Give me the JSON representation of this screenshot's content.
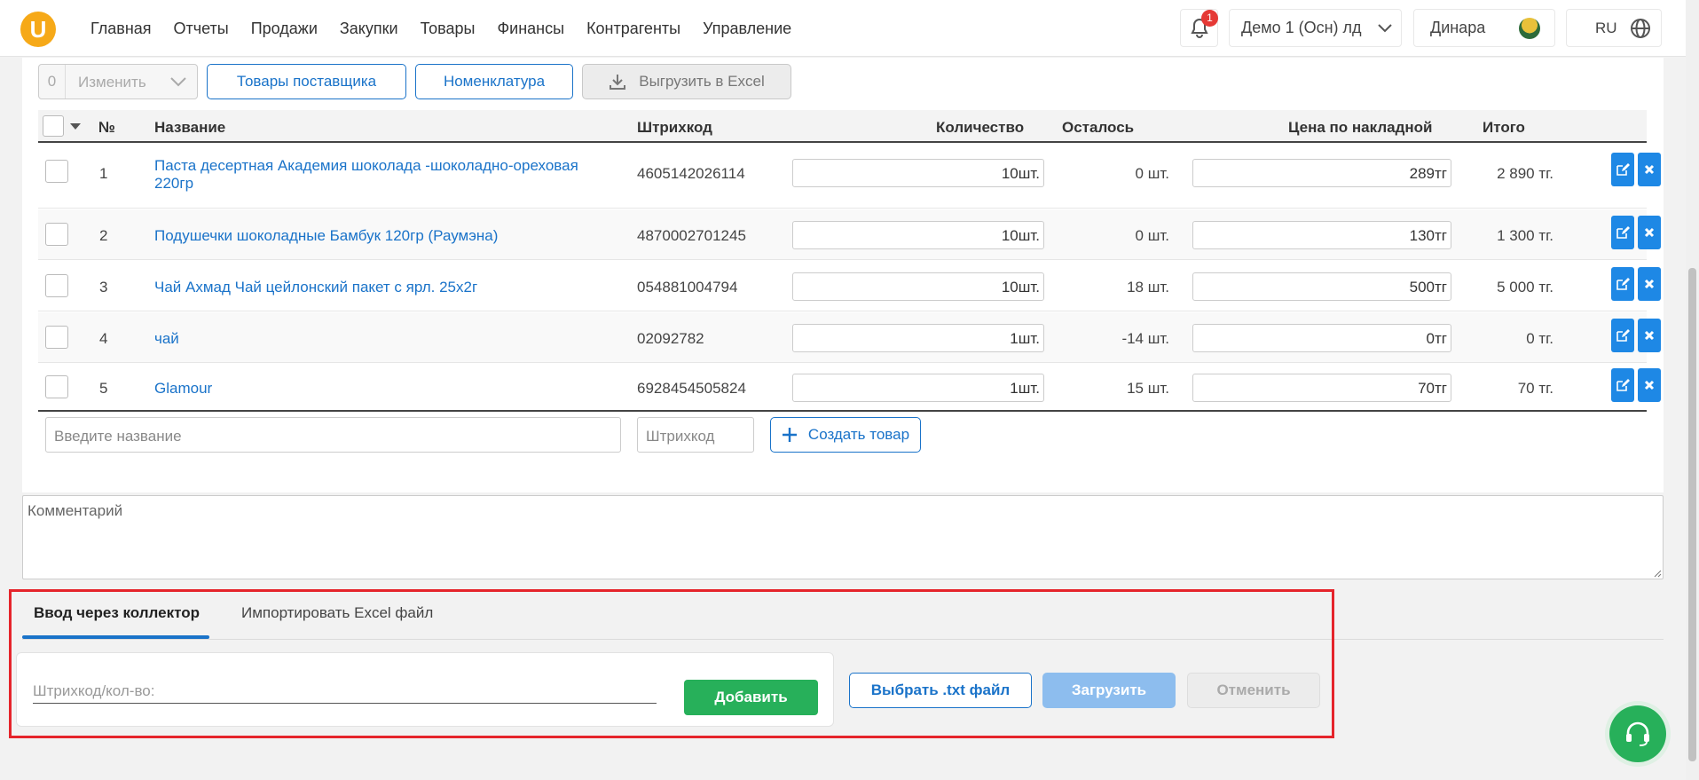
{
  "header": {
    "logo": "U",
    "nav": [
      "Главная",
      "Отчеты",
      "Продажи",
      "Закупки",
      "Товары",
      "Финансы",
      "Контрагенты",
      "Управление"
    ],
    "notifications_count": "1",
    "store": "Демо 1 (Осн) лд",
    "user": "Динара",
    "language": "RU"
  },
  "toolbar": {
    "selected_count": "0",
    "change_label": "Изменить",
    "supplier_goods": "Товары поставщика",
    "nomenclature": "Номенклатура",
    "export_excel": "Выгрузить в Excel"
  },
  "table": {
    "headers": {
      "num": "№",
      "name": "Название",
      "barcode": "Штрихкод",
      "qty": "Количество",
      "left": "Осталось",
      "price": "Цена по накладной",
      "total": "Итого"
    },
    "rows": [
      {
        "num": "1",
        "name": "Паста десертная Академия шоколада -шоколадно-ореховая 220гр",
        "barcode": "4605142026114",
        "qty": "10шт.",
        "left": "0 шт.",
        "price": "289тг",
        "total": "2 890 тг."
      },
      {
        "num": "2",
        "name": "Подушечки шоколадные Бамбук 120гр (Раумэна)",
        "barcode": "4870002701245",
        "qty": "10шт.",
        "left": "0 шт.",
        "price": "130тг",
        "total": "1 300 тг."
      },
      {
        "num": "3",
        "name": "Чай Ахмад Чай цейлонский пакет с ярл. 25х2г",
        "barcode": "054881004794",
        "qty": "10шт.",
        "left": "18 шт.",
        "price": "500тг",
        "total": "5 000 тг."
      },
      {
        "num": "4",
        "name": "чай",
        "barcode": "02092782",
        "qty": "1шт.",
        "left": "-14 шт.",
        "price": "0тг",
        "total": "0 тг."
      },
      {
        "num": "5",
        "name": "Glamour",
        "barcode": "6928454505824",
        "qty": "1шт.",
        "left": "15 шт.",
        "price": "70тг",
        "total": "70 тг."
      }
    ]
  },
  "add_row": {
    "name_placeholder": "Введите название",
    "barcode_placeholder": "Штрихкод",
    "create_label": "Создать товар"
  },
  "comment": {
    "placeholder": "Комментарий"
  },
  "collector": {
    "tab_collector": "Ввод через коллектор",
    "tab_import": "Импортировать Excel файл",
    "input_placeholder": "Штрихкод/кол-во:",
    "add_label": "Добавить",
    "choose_file": "Выбрать .txt файл",
    "upload": "Загрузить",
    "cancel": "Отменить"
  },
  "colors": {
    "accent": "#1a73c9",
    "green": "#27b05a",
    "highlight": "#e5242b",
    "logo": "#f6a918"
  }
}
